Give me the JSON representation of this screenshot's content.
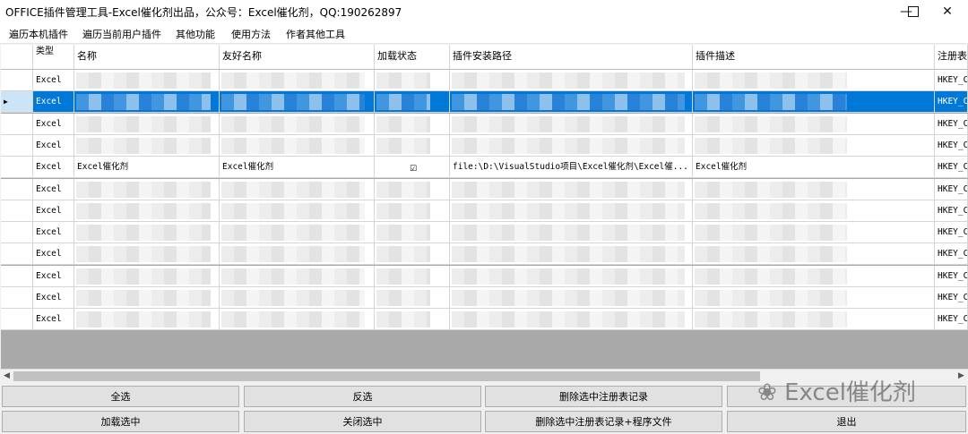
{
  "window": {
    "title": "OFFICE插件管理工具-Excel催化剂出品，公众号：Excel催化剂，QQ:190262897",
    "minimize_icon": "minimize-icon",
    "maximize_icon": "maximize-icon",
    "close_icon": "close-icon"
  },
  "menu": [
    "遍历本机插件",
    "遍历当前用户插件",
    "其他功能",
    "使用方法",
    "作者其他工具"
  ],
  "table": {
    "columns": [
      "类型",
      "名称",
      "友好名称",
      "加载状态",
      "插件安装路径",
      "插件描述",
      "注册表"
    ],
    "rows": [
      {
        "type": "Excel",
        "name": "",
        "friendly": "",
        "loaded": "",
        "path": "",
        "desc": "",
        "reg": "HKEY_CU"
      },
      {
        "type": "Excel",
        "name": "",
        "friendly": "",
        "loaded": "",
        "path": "",
        "desc": "",
        "reg": "HKEY_CU"
      },
      {
        "type": "Excel",
        "name": "",
        "friendly": "",
        "loaded": "",
        "path": "",
        "desc": "",
        "reg": "HKEY_CU"
      },
      {
        "type": "Excel",
        "name": "",
        "friendly": "",
        "loaded": "",
        "path": "",
        "desc": "",
        "reg": "HKEY_CU"
      },
      {
        "type": "Excel",
        "name": "Excel催化剂",
        "friendly": "Excel催化剂",
        "loaded": "☑",
        "path": "file:\\D:\\VisualStudio项目\\Excel催化剂\\Excel催...",
        "desc": "Excel催化剂",
        "reg": "HKEY_CU"
      },
      {
        "type": "Excel",
        "name": "",
        "friendly": "",
        "loaded": "",
        "path": "",
        "desc": "",
        "reg": "HKEY_CU"
      },
      {
        "type": "Excel",
        "name": "",
        "friendly": "",
        "loaded": "",
        "path": "",
        "desc": "",
        "reg": "HKEY_CU"
      },
      {
        "type": "Excel",
        "name": "",
        "friendly": "",
        "loaded": "",
        "path": "",
        "desc": "",
        "reg": "HKEY_CU"
      },
      {
        "type": "Excel",
        "name": "",
        "friendly": "",
        "loaded": "",
        "path": "",
        "desc": "",
        "reg": "HKEY_CU"
      },
      {
        "type": "Excel",
        "name": "",
        "friendly": "",
        "loaded": "",
        "path": "",
        "desc": "",
        "reg": "HKEY_CU"
      },
      {
        "type": "Excel",
        "name": "",
        "friendly": "",
        "loaded": "",
        "path": "",
        "desc": "",
        "reg": "HKEY_CU"
      },
      {
        "type": "Excel",
        "name": "",
        "friendly": "",
        "loaded": "",
        "path": "",
        "desc": "",
        "reg": "HKEY_CU"
      }
    ],
    "selected_row_indicator": "▶"
  },
  "buttons": {
    "select_all": "全选",
    "invert": "反选",
    "delete_reg": "删除选中注册表记录",
    "load_selected": "加载选中",
    "close_selected": "关闭选中",
    "delete_reg_files": "删除选中注册表记录+程序文件",
    "exit": "退出"
  },
  "watermark": "Excel催化剂"
}
